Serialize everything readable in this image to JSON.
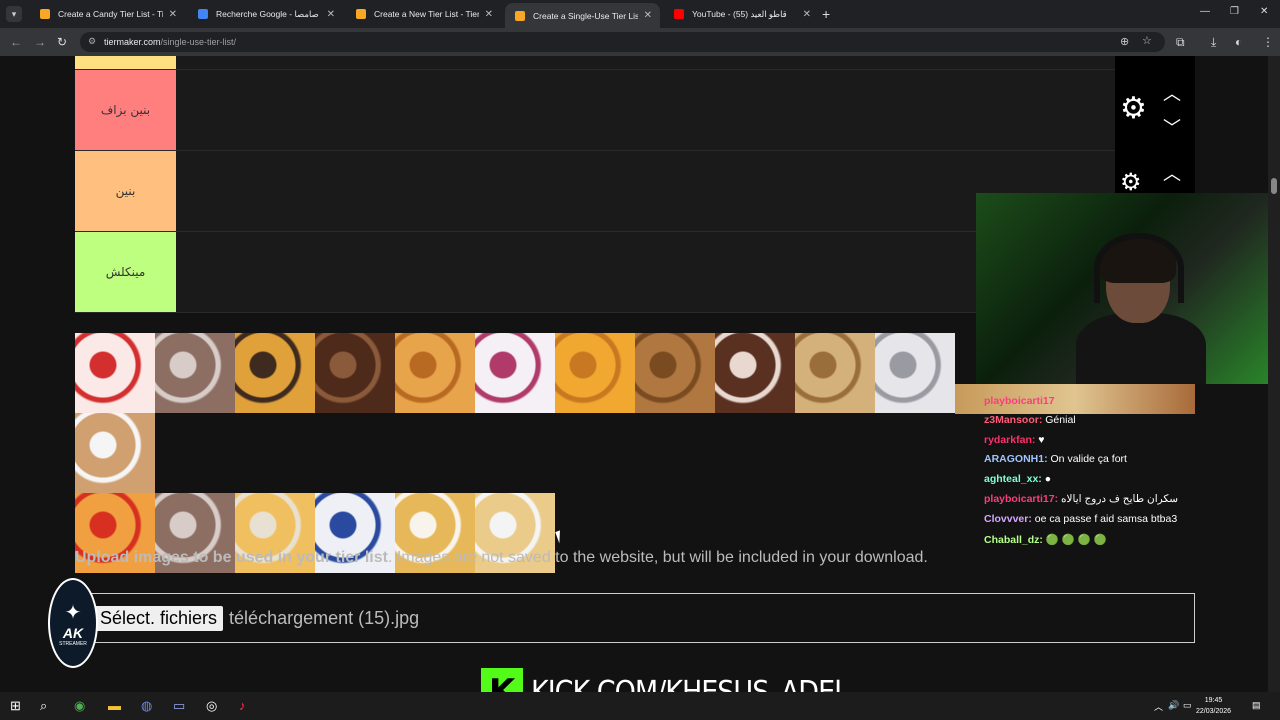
{
  "browser": {
    "tabs": [
      {
        "title": "Create a Candy Tier List - TierMaker",
        "color": "#f9a825"
      },
      {
        "title": "Recherche Google - صامصا",
        "color": "#4285f4"
      },
      {
        "title": "Create a New Tier List - TierMaker",
        "color": "#f9a825"
      },
      {
        "title": "Create a Single-Use Tier List (Pe",
        "color": "#f9a825",
        "active": true
      },
      {
        "title": "YouTube - قاطو العيد (55)",
        "color": "#ff0000"
      }
    ],
    "url_domain": "tiermaker.com",
    "url_path": "/single-use-tier-list/"
  },
  "tiers": [
    {
      "label": "",
      "color": "#ffdf80"
    },
    {
      "label": "بنين بزاف",
      "color": "#ff7f7f"
    },
    {
      "label": "بنين",
      "color": "#ffbf7f"
    },
    {
      "label": "مينكلش",
      "color": "#bfff7f"
    }
  ],
  "chat": [
    {
      "user": "playboicarti17",
      "text": "",
      "color": "#ff3b7f"
    },
    {
      "user": "z3Mansoor:",
      "text": "Génial",
      "color": "#ff5c7a"
    },
    {
      "user": "rydarkfan:",
      "text": "♥",
      "color": "#ff2f6d"
    },
    {
      "user": "ARAGONH1:",
      "text": "On valide ça fort",
      "color": "#a0c4ff"
    },
    {
      "user": "aghteal_xx:",
      "text": "●",
      "color": "#7fffd4"
    },
    {
      "user": "playboicarti17:",
      "text": "سكران طايح ف دروج ايالاه",
      "color": "#ff3b7f"
    },
    {
      "user": "Clovvver:",
      "text": "oe ca passe f aid samsa btba3",
      "color": "#d8a6ff"
    },
    {
      "user": "Chaball_dz:",
      "text": "🟢 🟢 🟢 🟢",
      "color": "#b6ff8a"
    }
  ],
  "upload": {
    "heading_bold": "Upload images to be used in your tier list",
    "heading_rest": ". Images are not saved to the website, but will be included in your download.",
    "button_label": "Sélect. fichiers",
    "file_name": "téléchargement (15).jpg"
  },
  "overlay": {
    "kick_url": "KICK.COM/KHESUS_ADEL",
    "logo_text": "AK",
    "logo_subtext": "STREAMER"
  },
  "taskbar": {
    "time": "19:45",
    "date": "22/03/2026"
  },
  "items": [
    {
      "c1": "#fbe9e7",
      "c2": "#d32f2f"
    },
    {
      "c1": "#8d6e63",
      "c2": "#d7ccc8"
    },
    {
      "c1": "#e0a03a",
      "c2": "#3e2a1e"
    },
    {
      "c1": "#4e2a1a",
      "c2": "#8b5a3a"
    },
    {
      "c1": "#e7a44a",
      "c2": "#b86a22"
    },
    {
      "c1": "#f5f0f5",
      "c2": "#b03a6a"
    },
    {
      "c1": "#f0a830",
      "c2": "#c87820"
    },
    {
      "c1": "#b07840",
      "c2": "#7a4a20"
    },
    {
      "c1": "#5a3020",
      "c2": "#e8d8d0"
    },
    {
      "c1": "#d4b07a",
      "c2": "#9a6e3a"
    },
    {
      "c1": "#e6e6ea",
      "c2": "#9a9aa2"
    },
    {
      "c1": "#d0a070",
      "c2": "#f5f5f5"
    },
    {
      "c1": "#f0a040",
      "c2": "#d83020"
    },
    {
      "c1": "#8d6e63",
      "c2": "#d7ccc8"
    },
    {
      "c1": "#f0c060",
      "c2": "#e8e0d0"
    },
    {
      "c1": "#eef0f6",
      "c2": "#2a4aa0"
    },
    {
      "c1": "#e6b85a",
      "c2": "#f8f4ec"
    },
    {
      "c1": "#eacb8a",
      "c2": "#f4f4f4"
    }
  ]
}
